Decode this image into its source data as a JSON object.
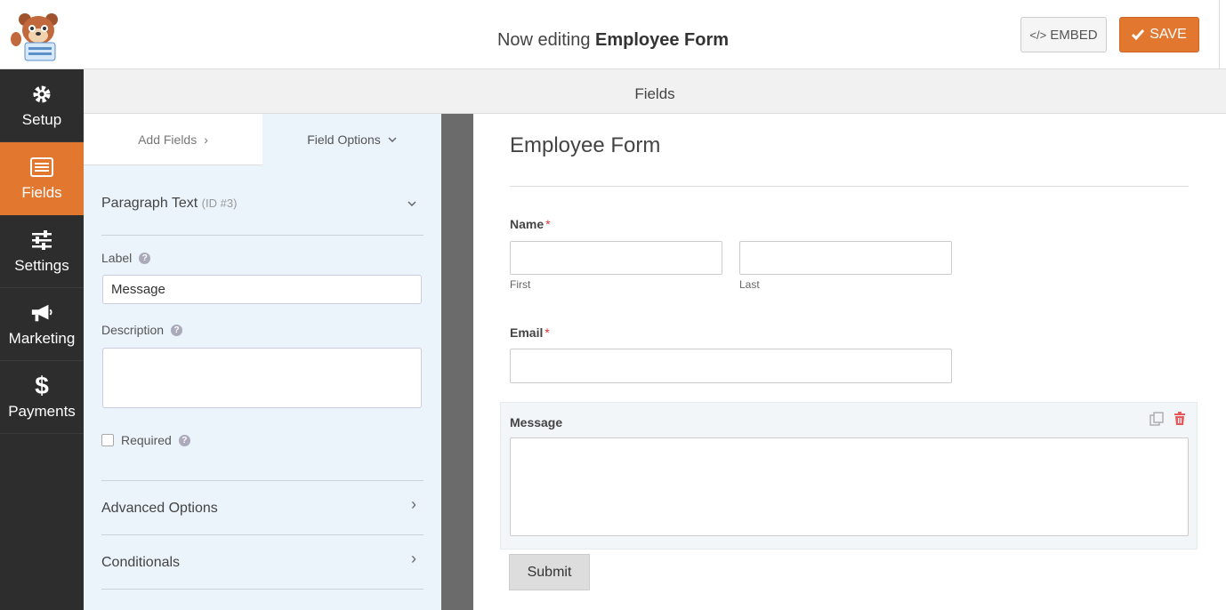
{
  "header": {
    "title_prefix": "Now editing",
    "form_name": "Employee Form",
    "embed_label": "EMBED",
    "save_label": "SAVE"
  },
  "sidebar": {
    "items": [
      {
        "label": "Setup",
        "icon": "gear-icon"
      },
      {
        "label": "Fields",
        "icon": "list-icon"
      },
      {
        "label": "Settings",
        "icon": "sliders-icon"
      },
      {
        "label": "Marketing",
        "icon": "megaphone-icon"
      },
      {
        "label": "Payments",
        "icon": "dollar-icon"
      }
    ],
    "active": "Fields"
  },
  "fields_bar": {
    "title": "Fields"
  },
  "panel": {
    "tabs": [
      {
        "label": "Add Fields"
      },
      {
        "label": "Field Options"
      }
    ],
    "field": {
      "name": "Paragraph Text",
      "id": "(ID #3)"
    },
    "label_caption": "Label",
    "label_value": "Message",
    "description_caption": "Description",
    "description_value": "",
    "required_label": "Required",
    "advanced_label": "Advanced Options",
    "conditionals_label": "Conditionals"
  },
  "preview": {
    "form_title": "Employee Form",
    "name_label": "Name",
    "name_required": "*",
    "first_sub": "First",
    "last_sub": "Last",
    "email_label": "Email",
    "email_required": "*",
    "message_label": "Message",
    "submit_label": "Submit"
  },
  "colors": {
    "accent": "#e27730",
    "sidebar_bg": "#2d2d2d",
    "panel_bg": "#ebf3fb",
    "required": "#d63638"
  }
}
